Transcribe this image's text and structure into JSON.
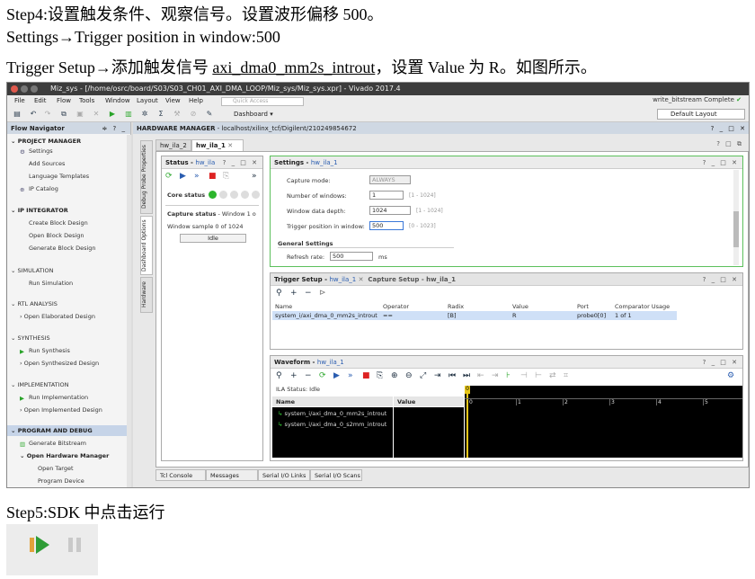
{
  "doc": {
    "step4": "Step4:设置触发条件、观察信号。设置波形偏移 500。",
    "settings_line": "Settings→Trigger position in window:500",
    "trigger_pre": "Trigger Setup→添加触发信号 ",
    "trigger_sig": "axi_dma0_mm2s_introut",
    "trigger_post": "，设置 Value 为 R。如图所示。",
    "step5": "Step5:SDK 中点击运行"
  },
  "window": {
    "title": "Miz_sys - [/home/osrc/board/S03/S03_CH01_AXI_DMA_LOOP/Miz_sys/Miz_sys.xpr] - Vivado 2017.4",
    "menu": [
      "File",
      "Edit",
      "Flow",
      "Tools",
      "Window",
      "Layout",
      "View",
      "Help"
    ],
    "quick_access": "Quick Access",
    "status_right": "write_bitstream Complete",
    "dashboard_label": "Dashboard ▾",
    "layout_select": "Default Layout"
  },
  "flow": {
    "header": "Flow Navigator",
    "sections": [
      {
        "title": "PROJECT MANAGER",
        "items": [
          "Settings",
          "Add Sources",
          "Language Templates",
          "IP Catalog"
        ]
      },
      {
        "title": "IP INTEGRATOR",
        "items": [
          "Create Block Design",
          "Open Block Design",
          "Generate Block Design"
        ]
      },
      {
        "title": "SIMULATION",
        "items": [
          "Run Simulation"
        ]
      },
      {
        "title": "RTL ANALYSIS",
        "items": [
          "Open Elaborated Design"
        ]
      },
      {
        "title": "SYNTHESIS",
        "items": [
          "Run Synthesis",
          "Open Synthesized Design"
        ]
      },
      {
        "title": "IMPLEMENTATION",
        "items": [
          "Run Implementation",
          "Open Implemented Design"
        ]
      },
      {
        "title": "PROGRAM AND DEBUG",
        "items": [
          "Generate Bitstream",
          "Open Hardware Manager",
          "Open Target",
          "Program Device"
        ]
      }
    ]
  },
  "hw": {
    "header": "HARDWARE MANAGER",
    "path": "- localhost/xilinx_tcf/Digilent/210249854672",
    "tabs": [
      "hw_ila_2",
      "hw_ila_1"
    ],
    "side_tabs": [
      "Debug Probe Properties",
      "Dashboard Options",
      "Hardware"
    ],
    "status": {
      "title": "Status",
      "sub": "hw_ila",
      "core_status": "Core status",
      "capture_status": "Capture status",
      "capture_state": "- Window 1 o",
      "window_sample": "Window sample 0 of 1024",
      "idle": "Idle"
    },
    "settings": {
      "title": "Settings",
      "sub": "hw_ila_1",
      "capture_mode_label": "Capture mode:",
      "capture_mode": "ALWAYS",
      "num_windows_label": "Number of windows:",
      "num_windows": "1",
      "num_windows_range": "[1 - 1024]",
      "depth_label": "Window data depth:",
      "depth": "1024",
      "depth_range": "[1 - 1024]",
      "trig_pos_label": "Trigger position in window:",
      "trig_pos": "500",
      "trig_pos_range": "[0 - 1023]",
      "general": "General Settings",
      "refresh_label": "Refresh rate:",
      "refresh": "500",
      "refresh_unit": "ms"
    },
    "trigger": {
      "title": "Trigger Setup",
      "sub": "hw_ila_1",
      "tab2": "Capture Setup - hw_ila_1",
      "columns": [
        "Name",
        "Operator",
        "Radix",
        "Value",
        "Port",
        "Comparator Usage"
      ],
      "row": [
        "system_i/axi_dma_0_mm2s_introut",
        "==",
        "[B]",
        "R",
        "probe0[0]",
        "1 of 1"
      ]
    },
    "waveform": {
      "title": "Waveform",
      "sub": "hw_ila_1",
      "ila_status": "ILA Status: Idle",
      "col_name": "Name",
      "col_value": "Value",
      "signals": [
        "system_i/axi_dma_0_mm2s_introut",
        "system_i/axi_dma_0_s2mm_introut"
      ],
      "marker": "0",
      "ticks": [
        "0",
        "1",
        "2",
        "3",
        "4",
        "5"
      ]
    },
    "bottom_tabs": [
      "Tcl Console",
      "Messages",
      "Serial I/O Links",
      "Serial I/O Scans"
    ]
  }
}
